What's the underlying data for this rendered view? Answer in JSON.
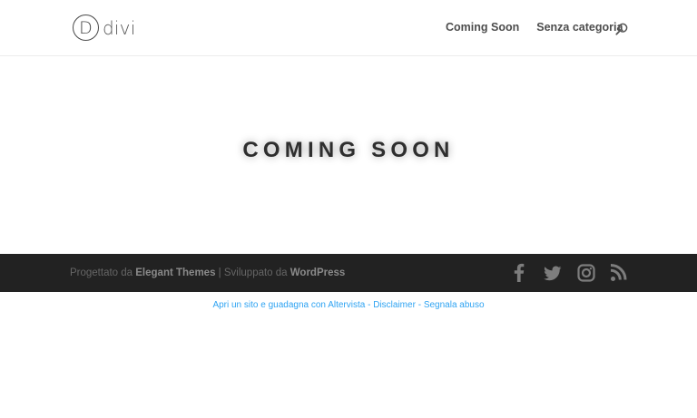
{
  "header": {
    "logo_mark": "D",
    "logo_text": "divi",
    "nav": [
      {
        "label": "Coming Soon"
      },
      {
        "label": "Senza categoria"
      }
    ],
    "search_icon": "search-icon"
  },
  "hero": {
    "title": "COMING SOON"
  },
  "footer": {
    "credits": {
      "prefix": "Progettato da",
      "theme": "Elegant Themes",
      "separator": "|",
      "middle": "Sviluppato da",
      "platform": "WordPress"
    },
    "social": [
      "facebook-icon",
      "twitter-icon",
      "instagram-icon",
      "rss-icon"
    ]
  },
  "bottom_links": {
    "link1": "Apri un sito e guadagna con Altervista",
    "sep1": "-",
    "link2": "Disclaimer",
    "sep2": "-",
    "link3": "Segnala abuso"
  },
  "colors": {
    "footer_bg": "#222222",
    "link": "#2ea3f2",
    "text_dark": "#2e2e2e"
  }
}
